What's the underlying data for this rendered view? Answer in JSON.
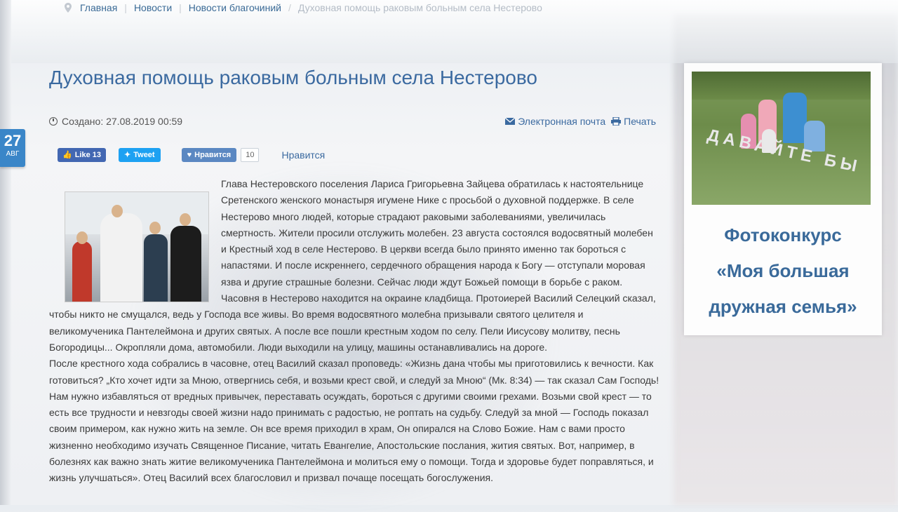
{
  "breadcrumb": {
    "items": [
      "Главная",
      "Новости",
      "Новости благочиний"
    ],
    "current": "Духовная помощь раковым больным села Нестерово"
  },
  "date_badge": {
    "day": "27",
    "month": "АВГ"
  },
  "article": {
    "title": "Духовная помощь раковым больным села Нестерово",
    "created": "Создано: 27.08.2019 00:59",
    "email_label": "Электронная почта",
    "print_label": "Печать",
    "paragraph1": "Глава Нестеровского поселения Лариса Григорьевна Зайцева обратилась к настоятельнице Сретенского женского монастыря игумене Нике с просьбой о духовной поддержке. В селе Нестерово много людей, которые страдают раковыми заболеваниями, увеличилась смертность. Жители просили отслужить молебен. 23 августа состоялся водосвятный молебен и Крестный ход в селе Нестерово. В церкви всегда было принято именно так бороться с напастями. И после искреннего, сердечного обращения народа к Богу — отступали моровая язва и другие страшные болезни. Сейчас люди ждут Божьей помощи в борьбе с раком. Часовня в Нестерово находится на окраине кладбища. Протоиерей Василий Селецкий сказал, чтобы никто не смущался, ведь у Господа все живы. Во время водосвятного молебна призывали святого целителя и великомученика Пантелеймона и других святых. А после все пошли крестным ходом по селу. Пели Иисусову молитву, песнь Богородицы... Окропляли дома, автомобили. Люди выходили на улицу, машины останавливались на дороге.",
    "paragraph2": "После крестного хода собрались в часовне, отец Василий сказал проповедь: «Жизнь дана чтобы мы приготовились к вечности. Как готовиться? „Кто хочет идти за Мною, отвергнись себя, и возьми крест свой, и следуй за Мною“ (Мк. 8:34) — так сказал Сам Господь! Нам нужно избавляться от вредных привычек, переставать осуждать, бороться с другими своими грехами. Возьми свой крест — то есть все трудности и невзгоды своей жизни надо принимать с радостью, не роптать на судьбу. Следуй за мной — Господь показал своим примером, как нужно жить на земле. Он все время приходил в храм, Он опирался на Слово Божие. Нам с вами просто жизненно необходимо изучать Священное Писание, читать Евангелие, Апостольские послания, жития святых. Вот, например, в болезнях как важно знать житие великомученика Пантелеймона и молиться ему о помощи. Тогда и здоровье будет поправляться, и жизнь улучшаться». Отец Василий всех благословил и призвал почаще посещать богослужения."
  },
  "social": {
    "fb_label": "Like 13",
    "tw_label": "Tweet",
    "vk_label": "Нравится",
    "vk_count": "10",
    "like_link": "Нравится"
  },
  "sidebar": {
    "photo_text": "ДАВАЙТЕ БЫ",
    "line1": "Фотоконкурс",
    "line2": "«Моя большая",
    "line3": "дружная семья»"
  },
  "colors": {
    "accent": "#3b6aa0",
    "badge": "#3a86c8",
    "facebook": "#4267b2",
    "twitter": "#1da1f2",
    "vk": "#5b88c2"
  }
}
